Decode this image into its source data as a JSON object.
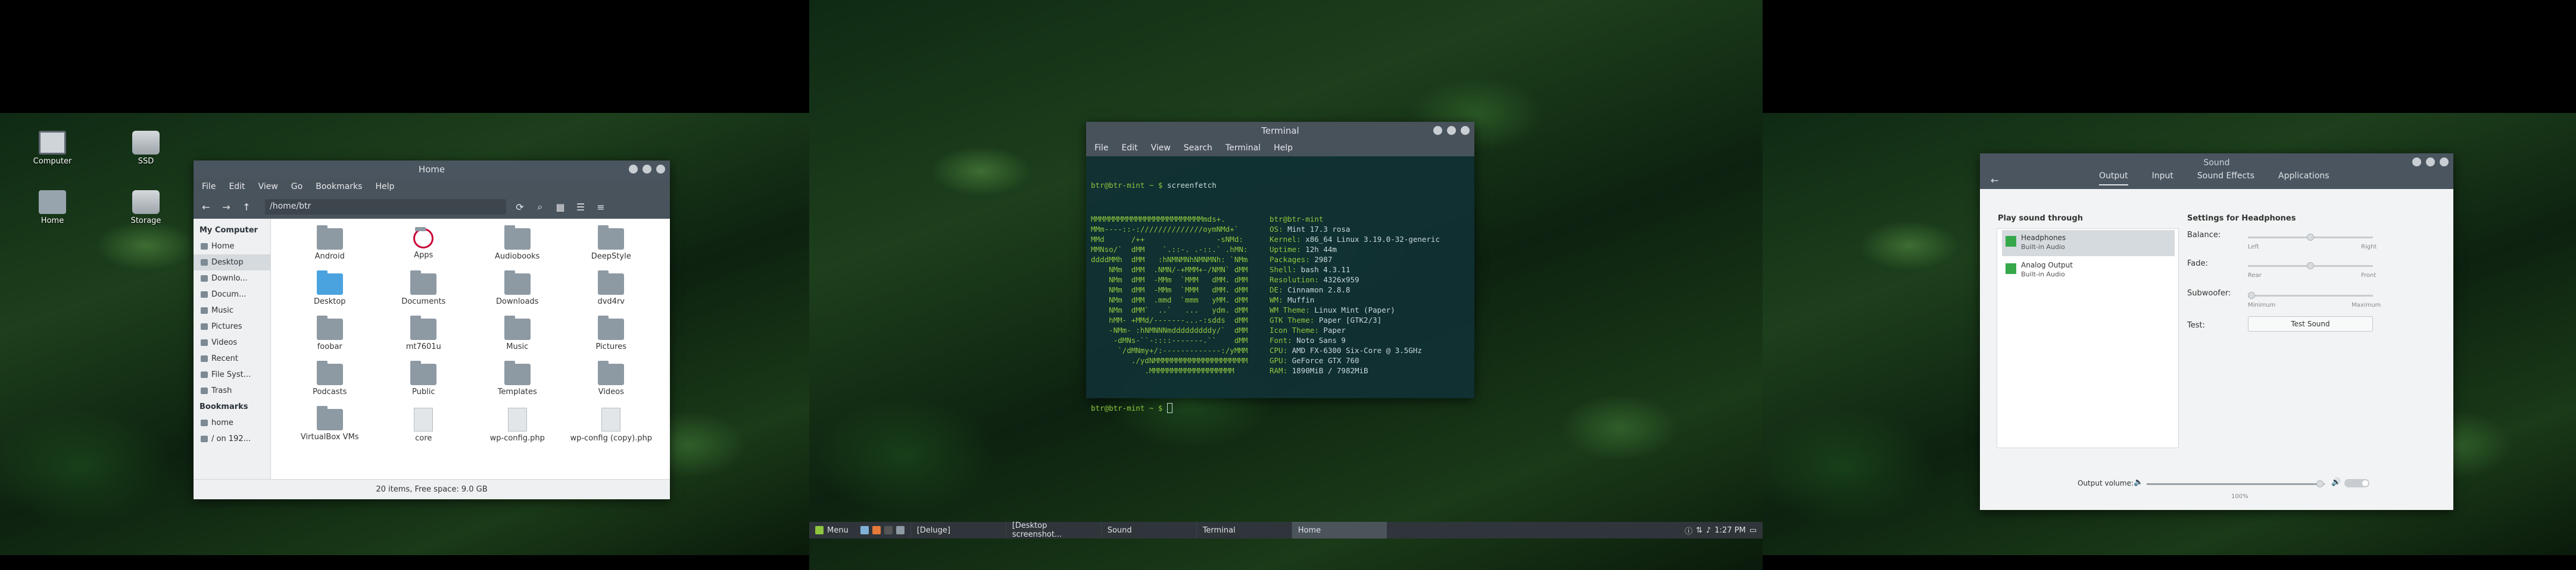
{
  "desktop_icons": [
    {
      "label": "Computer"
    },
    {
      "label": "SSD"
    },
    {
      "label": "Home"
    },
    {
      "label": "Storage"
    }
  ],
  "file_manager": {
    "title": "Home",
    "menu": [
      "File",
      "Edit",
      "View",
      "Go",
      "Bookmarks",
      "Help"
    ],
    "path": "/home/btr",
    "sidebar_my_computer": "My Computer",
    "sidebar_items": [
      "Home",
      "Desktop",
      "Downlo...",
      "Docum...",
      "Music",
      "Pictures",
      "Videos",
      "Recent",
      "File Syst...",
      "Trash"
    ],
    "sidebar_bookmarks": "Bookmarks",
    "bookmark_items": [
      "home",
      "/ on 192..."
    ],
    "files": [
      {
        "name": "Android",
        "kind": "folder"
      },
      {
        "name": "Apps",
        "kind": "debian"
      },
      {
        "name": "Audiobooks",
        "kind": "folder"
      },
      {
        "name": "DeepStyle",
        "kind": "folder"
      },
      {
        "name": "Desktop",
        "kind": "blue"
      },
      {
        "name": "Documents",
        "kind": "folder"
      },
      {
        "name": "Downloads",
        "kind": "folder"
      },
      {
        "name": "dvd4rv",
        "kind": "folder"
      },
      {
        "name": "foobar",
        "kind": "folder"
      },
      {
        "name": "mt7601u",
        "kind": "folder"
      },
      {
        "name": "Music",
        "kind": "folder"
      },
      {
        "name": "Pictures",
        "kind": "folder"
      },
      {
        "name": "Podcasts",
        "kind": "folder"
      },
      {
        "name": "Public",
        "kind": "folder"
      },
      {
        "name": "Templates",
        "kind": "folder"
      },
      {
        "name": "Videos",
        "kind": "folder"
      },
      {
        "name": "VirtualBox VMs",
        "kind": "folder"
      },
      {
        "name": "core",
        "kind": "file"
      },
      {
        "name": "wp-config.php",
        "kind": "file"
      },
      {
        "name": "wp-config (copy).php",
        "kind": "file"
      }
    ],
    "status": "20 items, Free space: 9.0 GB"
  },
  "terminal": {
    "title": "Terminal",
    "menu": [
      "File",
      "Edit",
      "View",
      "Search",
      "Terminal",
      "Help"
    ],
    "prompt": "btr@btr-mint ~ $ ",
    "command": "screenfetch",
    "art": [
      "MMMMMMMMMMMMMMMMMMMMMMMMMmds+.",
      "MMm----::-://////////////oymNMd+`",
      "MMd      /++                -sNMd:",
      "MMNso/`  dMM    `.::-. .-::.` .hMN:",
      "ddddMMh  dMM   :hNMNMNhNMNMNh: `NMm",
      "    NMm  dMM  .NMN/-+MMM+-/NMN` dMM",
      "    NMm  dMM  -MMm  `MMM   dMM. dMM",
      "    NMm  dMM  -MMm  `MMM   dMM. dMM",
      "    NMm  dMM  .mmd  `mmm   yMM. dMM",
      "    NMm  dMM`  ..`   ...   ydm. dMM",
      "    hMM- +MMd/-------...-:sdds  dMM",
      "    -NMm- :hNMNNNmdddddddddy/`  dMM",
      "     -dMNs-``-::::-------.``    dMM",
      "      `/dMNmy+/:-------------:/yMMM",
      "         ./ydNMMMMMMMMMMMMMMMMMMMMM",
      "            .MMMMMMMMMMMMMMMMMMM"
    ],
    "info": [
      {
        "k": "",
        "v": "btr@btr-mint"
      },
      {
        "k": "OS:",
        "v": " Mint 17.3 rosa"
      },
      {
        "k": "Kernel:",
        "v": " x86_64 Linux 3.19.0-32-generic"
      },
      {
        "k": "Uptime:",
        "v": " 12h 44m"
      },
      {
        "k": "Packages:",
        "v": " 2987"
      },
      {
        "k": "Shell:",
        "v": " bash 4.3.11"
      },
      {
        "k": "Resolution:",
        "v": " 4326x959"
      },
      {
        "k": "DE:",
        "v": " Cinnamon 2.8.8"
      },
      {
        "k": "WM:",
        "v": " Muffin"
      },
      {
        "k": "WM Theme:",
        "v": " Linux Mint (Paper)"
      },
      {
        "k": "GTK Theme:",
        "v": " Paper [GTK2/3]"
      },
      {
        "k": "Icon Theme:",
        "v": " Paper"
      },
      {
        "k": "Font:",
        "v": " Noto Sans 9"
      },
      {
        "k": "CPU:",
        "v": " AMD FX-6300 Six-Core @ 3.5GHz"
      },
      {
        "k": "GPU:",
        "v": " GeForce GTX 760"
      },
      {
        "k": "RAM:",
        "v": " 1890MiB / 7982MiB"
      }
    ],
    "prompt2": "btr@btr-mint ~ $ "
  },
  "sound": {
    "title": "Sound",
    "tabs": [
      "Output",
      "Input",
      "Sound Effects",
      "Applications"
    ],
    "play_through": "Play sound through",
    "devices": [
      {
        "name": "Headphones",
        "sub": "Built-in Audio"
      },
      {
        "name": "Analog Output",
        "sub": "Built-in Audio"
      }
    ],
    "settings_for": "Settings for Headphones",
    "balance": "Balance:",
    "left": "Left",
    "right": "Right",
    "fade": "Fade:",
    "rear": "Rear",
    "front": "Front",
    "subwoofer": "Subwoofer:",
    "minimum": "Minimum",
    "maximum": "Maximum",
    "test": "Test:",
    "test_button": "Test Sound",
    "output_volume": "Output volume:",
    "volume_pct": "100%",
    "volume_fraction": 1.0
  },
  "taskbar": {
    "menu": "Menu",
    "windows": [
      "[Deluge]",
      "[Desktop screenshot...",
      "Sound",
      "Terminal",
      "Home"
    ],
    "clock": "1:27 PM"
  },
  "colors": {
    "accent": "#8ec63f",
    "titlebar": "#4a5560",
    "panel": "#2f353a"
  }
}
